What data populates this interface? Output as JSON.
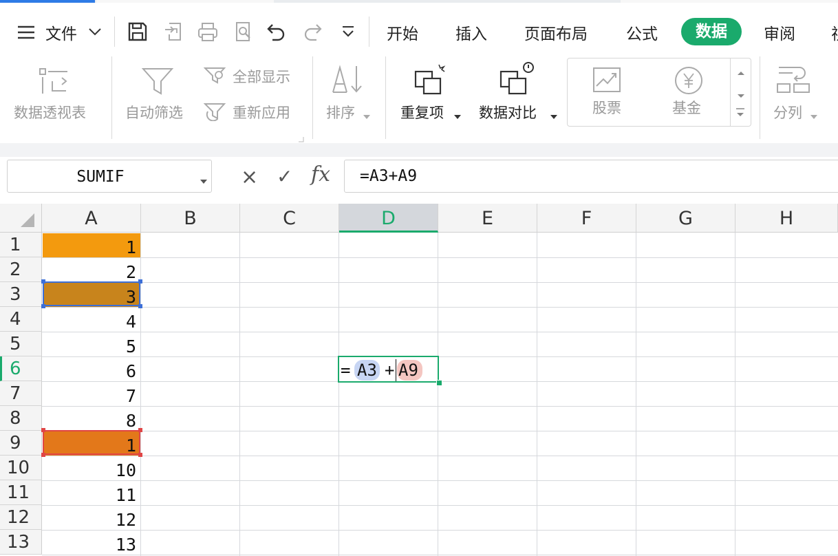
{
  "menu": {
    "file_label": "文件",
    "tabs": [
      "开始",
      "插入",
      "页面布局",
      "公式",
      "数据",
      "审阅",
      "视"
    ],
    "active_tab": "数据",
    "active_color": "#1aaa6c"
  },
  "quick_access": {
    "icons": [
      "save-icon",
      "export-icon",
      "print-icon",
      "print-preview-icon",
      "undo-icon",
      "redo-icon",
      "more-icon"
    ]
  },
  "ribbon": {
    "pivot_label": "数据透视表",
    "autofilter_label": "自动筛选",
    "show_all_label": "全部显示",
    "reapply_label": "重新应用",
    "sort_label": "排序",
    "duplicates_label": "重复项",
    "compare_label": "数据对比",
    "stock_label": "股票",
    "fund_label": "基金",
    "split_label": "分列"
  },
  "formula_bar": {
    "name_box": "SUMIF",
    "cancel_symbol": "×",
    "confirm_symbol": "✓",
    "fx_label": "fx",
    "formula": "=A3+A9"
  },
  "grid": {
    "columns": [
      "A",
      "B",
      "C",
      "D",
      "E",
      "F",
      "G",
      "H"
    ],
    "selected_column": "D",
    "rows": [
      "1",
      "2",
      "3",
      "4",
      "5",
      "6",
      "7",
      "8",
      "9",
      "10",
      "11",
      "12",
      "13"
    ],
    "selected_row": "6",
    "column_a_values": [
      "1",
      "2",
      "3",
      "4",
      "5",
      "6",
      "7",
      "8",
      "1",
      "10",
      "11",
      "12",
      "13"
    ],
    "editing_cell": {
      "equals": "=",
      "ref1": "A3",
      "plus": "+",
      "ref2": "A9"
    },
    "colors": {
      "highlight_orange": "#f39a0e",
      "ref1_border": "#3c6fd8",
      "ref2_border": "#e04545",
      "ref1_chip": "#c7d5f3",
      "ref2_chip": "#f4c6c1",
      "active_border": "#1aaa6c"
    }
  }
}
